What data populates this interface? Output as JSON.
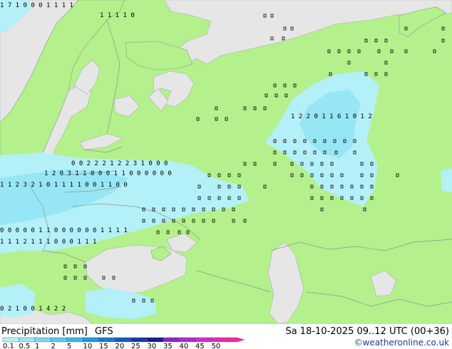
{
  "legend": {
    "title": "Precipitation [mm]",
    "model": "GFS",
    "datetime": "Sa 18-10-2025 09..12 UTC (00+36)",
    "credit": "©weatheronline.co.uk",
    "scale_labels": [
      "0.1",
      "0.5",
      "1",
      "2",
      "5",
      "10",
      "15",
      "20",
      "25",
      "30",
      "35",
      "40",
      "45",
      "50"
    ],
    "scale_colors": [
      "#b4f0f8",
      "#96e6f5",
      "#78d8f2",
      "#5ac8ee",
      "#3cb5e8",
      "#1e9ae0",
      "#1a7ad2",
      "#1a58c0",
      "#1a36aa",
      "#1a1a8c",
      "#8c28c8",
      "#b428d2",
      "#d228d2",
      "#e628b4",
      "#f028a0"
    ]
  },
  "map": {
    "colors": {
      "land": "#b4f08c",
      "sea": "#e6e6e6",
      "border": "#8c9a8c",
      "precip_light": "#b4f0f8",
      "precip_mid": "#96e6f5"
    },
    "grid_values": [
      {
        "row": 0,
        "text": "1 7 1 0 0 0 1 1 1 1"
      },
      {
        "row": 1,
        "text": "1 1 1 1 0"
      },
      {
        "row": 2,
        "text": "1 2 2 0 1 1 6 1 0 1 2"
      },
      {
        "row": 3,
        "text": "0 0 2 2 2 1 2 2 3 1 0 0 0"
      },
      {
        "row": 4,
        "text": "1 2 0 3 1 1 0 0 0 1 1 0 0 0 0 0 0"
      },
      {
        "row": 5,
        "text": "1 1 2 3 2 1 0 1 1 1 1 0 0 1 1 0 0"
      },
      {
        "row": 6,
        "text": "0 0 0 0 0 1 1 0 0 0 0 0 0 1 1 1 1"
      },
      {
        "row": 7,
        "text": "1 1 1 2 1 1 1 0 0 0 1 1 1"
      },
      {
        "row": 8,
        "text": "0 2 1 0 0 1 4 2 2"
      }
    ]
  }
}
